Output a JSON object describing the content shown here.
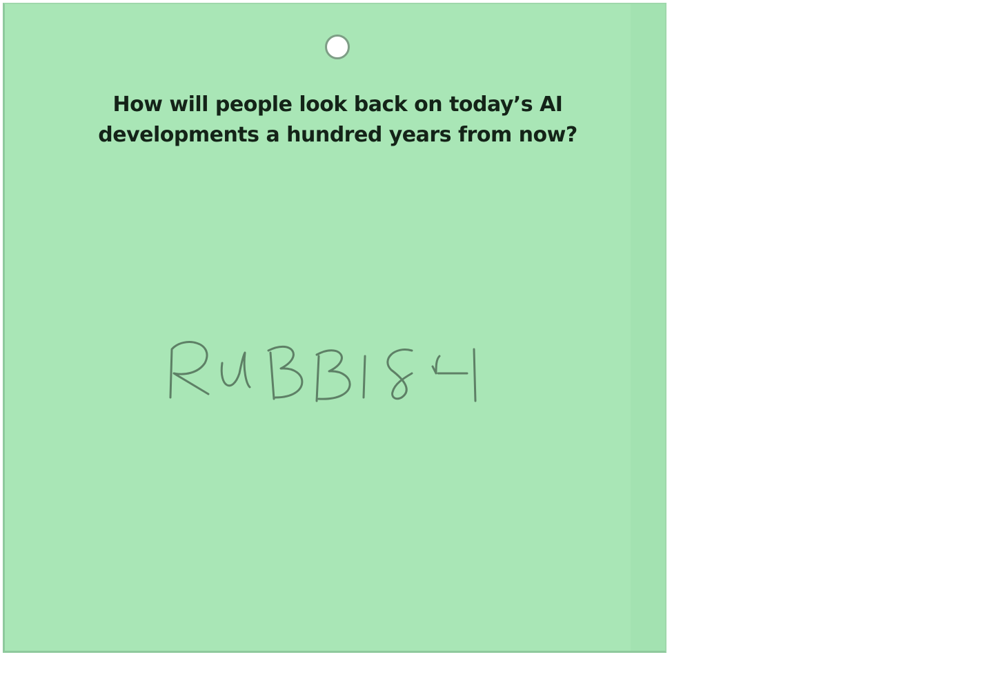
{
  "card": {
    "question_line1": "How will people look back on today’s AI",
    "question_line2": "developments a hundred years from now?",
    "handwritten_answer": "RUBBISH",
    "background_color": "#a9e6b6",
    "ink_color": "#5e8066",
    "text_color": "#142318"
  }
}
